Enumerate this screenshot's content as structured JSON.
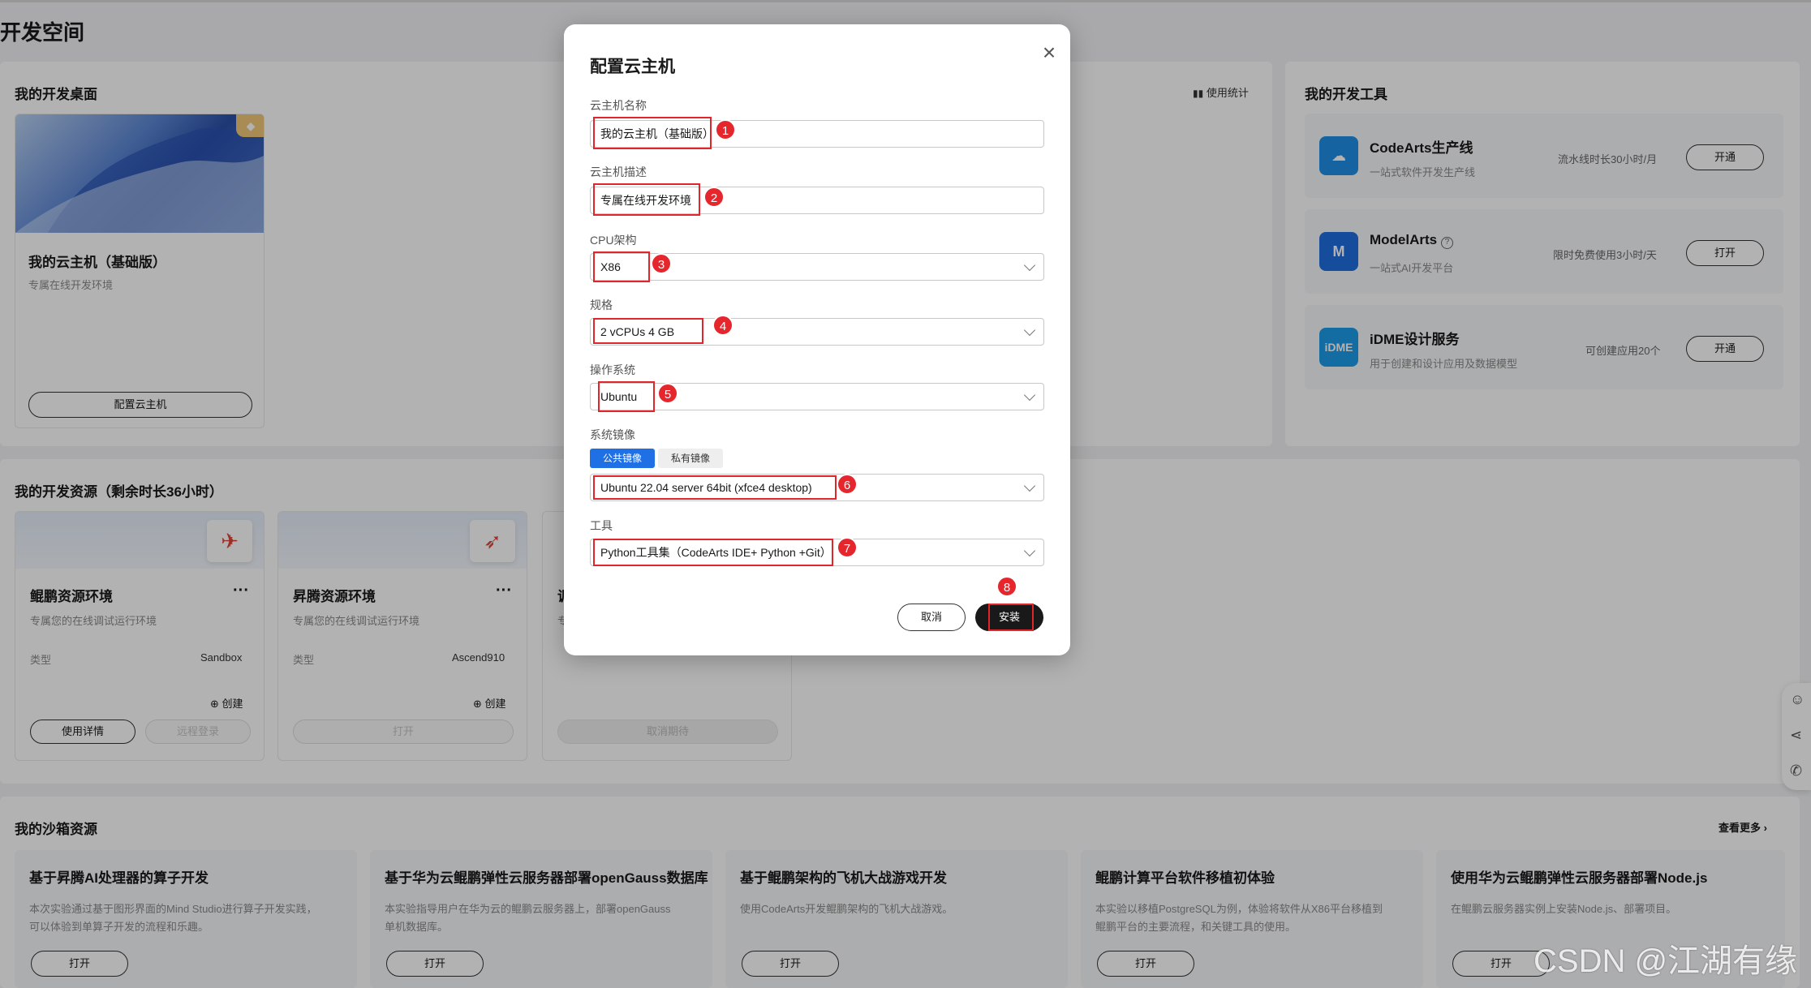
{
  "page": {
    "title": "开发空间"
  },
  "desktop": {
    "section_title": "我的开发桌面",
    "usage_stats": "使用统计",
    "vm_name": "我的云主机（基础版）",
    "vm_desc": "专属在线开发环境",
    "config_button": "配置云主机"
  },
  "tools": {
    "section_title": "我的开发工具",
    "items": [
      {
        "name": "CodeArts生产线",
        "desc": "一站式软件开发生产线",
        "quota": "流水线时长30小时/月",
        "action": "开通",
        "icon": "codearts-icon",
        "color": "#1f8fe5"
      },
      {
        "name": "ModelArts",
        "desc": "一站式AI开发平台",
        "quota": "限时免费使用3小时/天",
        "action": "打开",
        "icon": "modelarts-icon",
        "color": "#1f6fe0"
      },
      {
        "name": "iDME设计服务",
        "desc": "用于创建和设计应用及数据模型",
        "quota": "可创建应用20个",
        "action": "开通",
        "icon": "idme-icon",
        "color": "#1d9de8",
        "icon_text": "iDME"
      }
    ]
  },
  "resources": {
    "section_title": "我的开发资源（剩余时长36小时）",
    "items": [
      {
        "name": "鲲鹏资源环境",
        "desc": "专属您的在线调试运行环境",
        "type_label": "类型",
        "type_value": "Sandbox",
        "create": "创建",
        "btn1": "使用详情",
        "btn2": "远程登录"
      },
      {
        "name": "昇腾资源环境",
        "desc": "专属您的在线调试运行环境",
        "type_label": "类型",
        "type_value": "Ascend910",
        "create": "创建",
        "btn1": "打开"
      },
      {
        "name": "调",
        "desc": "专",
        "btn1": "取消期待"
      }
    ]
  },
  "sandbox": {
    "section_title": "我的沙箱资源",
    "view_more": "查看更多",
    "items": [
      {
        "title": "基于昇腾AI处理器的算子开发",
        "desc1": "本次实验通过基于图形界面的Mind Studio进行算子开发实践，",
        "desc2": "可以体验到单算子开发的流程和乐趣。",
        "action": "打开"
      },
      {
        "title": "基于华为云鲲鹏弹性云服务器部署openGauss数据库",
        "desc1": "本实验指导用户在华为云的鲲鹏云服务器上，部署openGauss",
        "desc2": "单机数据库。",
        "action": "打开"
      },
      {
        "title": "基于鲲鹏架构的飞机大战游戏开发",
        "desc1": "使用CodeArts开发鲲鹏架构的飞机大战游戏。",
        "desc2": "",
        "action": "打开"
      },
      {
        "title": "鲲鹏计算平台软件移植初体验",
        "desc1": "本实验以移植PostgreSQL为例，体验将软件从X86平台移植到",
        "desc2": "鲲鹏平台的主要流程，和关键工具的使用。",
        "action": "打开"
      },
      {
        "title": "使用华为云鲲鹏弹性云服务器部署Node.js",
        "desc1": "在鲲鹏云服务器实例上安装Node.js、部署项目。",
        "desc2": "",
        "action": "打开"
      }
    ]
  },
  "modal": {
    "title": "配置云主机",
    "name_label": "云主机名称",
    "name_value": "我的云主机（基础版）",
    "desc_label": "云主机描述",
    "desc_value": "专属在线开发环境",
    "cpu_label": "CPU架构",
    "cpu_value": "X86",
    "spec_label": "规格",
    "spec_value": "2 vCPUs 4 GB",
    "os_label": "操作系统",
    "os_value": "Ubuntu",
    "image_label": "系统镜像",
    "image_tab_public": "公共镜像",
    "image_tab_private": "私有镜像",
    "image_value": "Ubuntu 22.04 server 64bit (xfce4 desktop)",
    "tool_label": "工具",
    "tool_value": "Python工具集（CodeArts IDE+ Python +Git）",
    "cancel": "取消",
    "install": "安装",
    "badges": [
      "1",
      "2",
      "3",
      "4",
      "5",
      "6",
      "7",
      "8"
    ]
  },
  "watermark": "CSDN @江湖有缘",
  "colors": {
    "accent": "#1f6fe5",
    "annotation": "#e0262a",
    "primary_button": "#191919"
  }
}
